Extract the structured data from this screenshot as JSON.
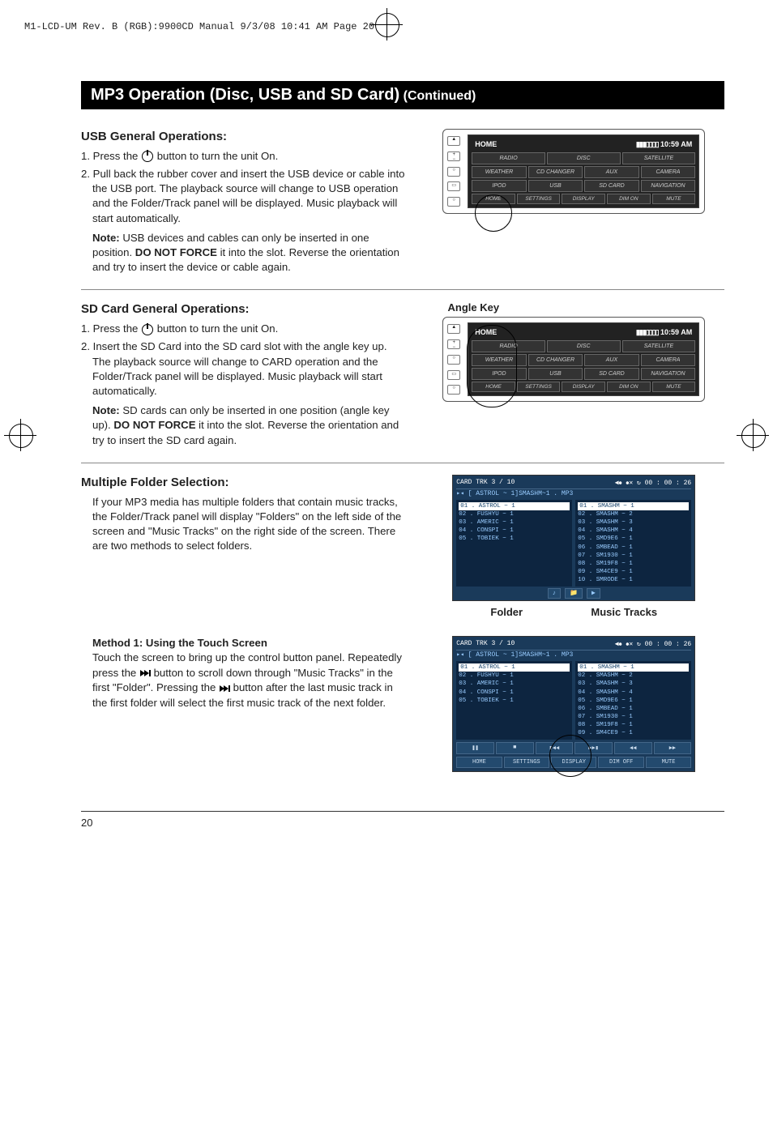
{
  "meta": {
    "header_line": "M1-LCD-UM Rev. B (RGB):9900CD Manual  9/3/08  10:41 AM  Page 20"
  },
  "title": {
    "main": "MP3 Operation (Disc, USB and SD Card)",
    "continued": "(Continued)"
  },
  "usb": {
    "heading": "USB General Operations:",
    "step1a": "1. Press the ",
    "step1b": " button to turn the unit On.",
    "step2": "2. Pull back the rubber cover and insert the USB device or cable into the USB port. The playback source will change to USB operation and the Folder/Track panel will be displayed. Music playback will start automatically.",
    "note_label": "Note:",
    "note_a": " USB devices and cables can only be inserted in one position. ",
    "note_bold": "DO NOT FORCE",
    "note_b": " it into the slot. Reverse the orientation and try to insert the device or cable again."
  },
  "sd": {
    "heading": "SD Card General Operations:",
    "step1a": "1. Press the ",
    "step1b": " button to turn the unit On.",
    "step2": "2. Insert the SD Card into the SD card slot with the angle key up. The playback source will change to CARD operation and the Folder/Track panel will be displayed. Music playback will start automatically.",
    "note_label": "Note:",
    "note_a": " SD cards can only be inserted in one position (angle key up). ",
    "note_bold": "DO NOT FORCE",
    "note_b": " it into the slot. Reverse the orientation and try to insert the SD card again.",
    "angle_label": "Angle Key"
  },
  "folders": {
    "heading": "Multiple Folder Selection:",
    "body": "If your MP3 media has multiple folders that contain music tracks, the Folder/Track panel will display \"Folders\" on the left side of the screen and \"Music Tracks\" on the right side of the screen. There are two methods to select folders.",
    "caption_left": "Folder",
    "caption_right": "Music Tracks"
  },
  "method1": {
    "heading": "Method 1: Using the Touch Screen",
    "body_a": "Touch the screen to bring up the control button panel. Repeatedly press the ",
    "body_b": " button to scroll down through \"Music Tracks\"  in the first \"Folder\". Pressing the ",
    "body_c": " button after the last music track in the first folder will select the first music track of the next folder."
  },
  "home_screen": {
    "title": "HOME",
    "clock": "10:59 AM",
    "row1": [
      "RADIO",
      "DISC",
      "SATELLITE"
    ],
    "row2": [
      "WEATHER",
      "CD CHANGER",
      "AUX",
      "CAMERA"
    ],
    "row3": [
      "IPOD",
      "USB",
      "SD CARD",
      "NAVIGATION"
    ],
    "row4": [
      "HOME",
      "SETTINGS",
      "DISPLAY",
      "DIM ON",
      "MUTE"
    ]
  },
  "mp3_screen": {
    "hdr_left": "CARD   TRK  3 / 10",
    "hdr_right": "00 : 00 : 26",
    "path": "[ ASTROL ~ 1]SMASHM~1 . MP3",
    "folders": [
      "01 . ASTROL ~ 1",
      "02 . FUSHYU ~ 1",
      "03 . AMERIC ~ 1",
      "04 . CONSPI ~ 1",
      "05 . TOBIEK ~ 1"
    ],
    "tracks1": [
      "01 . SMASHM ~ 1",
      "02 . SMASHM ~ 2",
      "03 . SMASHM ~ 3",
      "04 . SMASHM ~ 4",
      "05 . SMD9E6 ~ 1",
      "06 . SMBEAD ~ 1",
      "07 . SM1930 ~ 1",
      "08 . SM19F8 ~ 1",
      "09 . SM4CE9 ~ 1",
      "10 . SMRODE ~ 1"
    ],
    "tracks2": [
      "01 . SMASHM ~ 1",
      "02 . SMASHM ~ 2",
      "03 . SMASHM ~ 3",
      "04 . SMASHM ~ 4",
      "05 . SMD9E6 ~ 1",
      "06 . SMBEAD ~ 1",
      "07 . SM1930 ~ 1",
      "08 . SM19F8 ~ 1",
      "09 . SM4CE9 ~ 1"
    ],
    "ctrl_row1": [
      "❚❚",
      "■",
      "▮◀◀",
      "▶▶▮",
      "◀◀",
      "▶▶"
    ],
    "ctrl_row2": [
      "HOME",
      "SETTINGS",
      "DISPLAY",
      "DIM OFF",
      "MUTE"
    ]
  },
  "page_number": "20"
}
